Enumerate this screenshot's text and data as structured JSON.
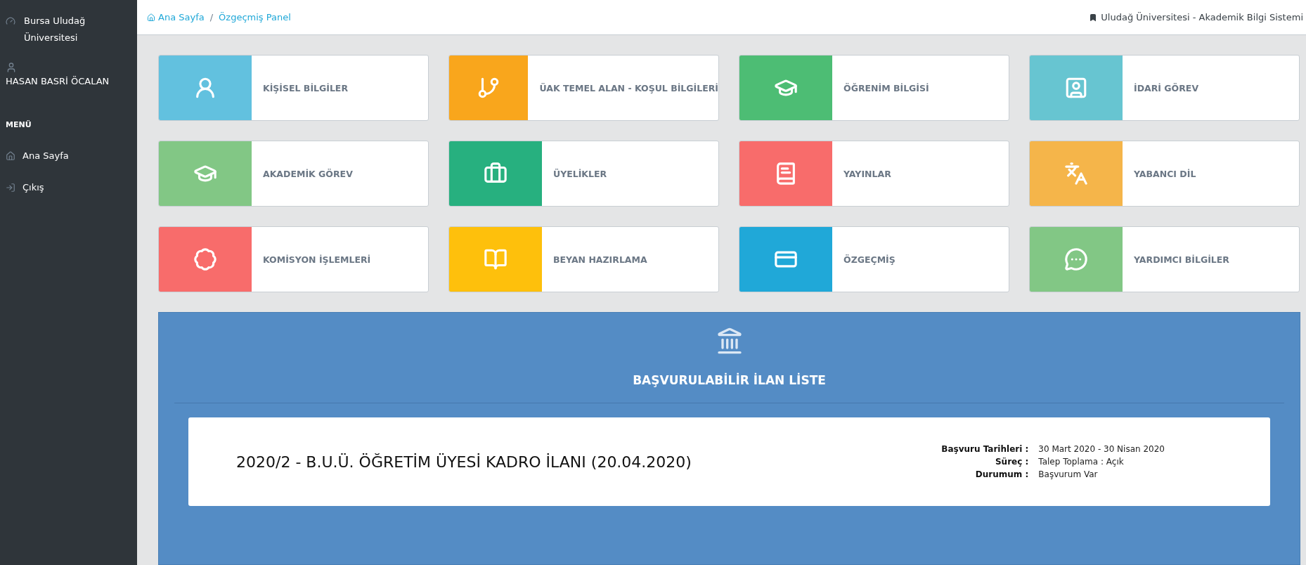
{
  "sidebar": {
    "brand": "Bursa Uludağ Üniversitesi",
    "user": "HASAN BASRİ ÖCALAN",
    "menu_heading": "MENÜ",
    "items": [
      {
        "label": "Ana Sayfa"
      },
      {
        "label": "Çıkış"
      }
    ]
  },
  "breadcrumb": [
    {
      "label": "Ana Sayfa"
    },
    {
      "label": "Özgeçmiş Panel"
    }
  ],
  "breadcrumb_separator": "/",
  "system_title": "Uludağ Üniversitesi - Akademik Bilgi Sistemi",
  "tiles": [
    {
      "label": "KİŞİSEL BİLGİLER",
      "color": "#62c1df"
    },
    {
      "label": "ÜAK TEMEL ALAN - KOŞUL BİLGİLERİ",
      "color": "#f9a61c"
    },
    {
      "label": "ÖĞRENİM BİLGİSİ",
      "color": "#4dbd74"
    },
    {
      "label": "İDARİ GÖREV",
      "color": "#67c5d1"
    },
    {
      "label": "AKADEMİK GÖREV",
      "color": "#82c785"
    },
    {
      "label": "ÜYELİKLER",
      "color": "#27b07f"
    },
    {
      "label": "YAYINLAR",
      "color": "#f86c6b"
    },
    {
      "label": "YABANCI DİL",
      "color": "#f5b54a"
    },
    {
      "label": "KOMİSYON İŞLEMLERİ",
      "color": "#f86c6b"
    },
    {
      "label": "BEYAN HAZIRLAMA",
      "color": "#fec00c"
    },
    {
      "label": "ÖZGEÇMİŞ",
      "color": "#20a8d8"
    },
    {
      "label": "YARDIMCI BİLGİLER",
      "color": "#82c785"
    }
  ],
  "announcements": {
    "title": "BAŞVURULABİLİR İLAN LİSTE",
    "items": [
      {
        "title": "2020/2 - B.U.Ü. ÖĞRETİM ÜYESİ KADRO İLANI (20.04.2020)",
        "details": [
          {
            "label": "Başvuru Tarihleri :",
            "value": "30 Mart 2020 - 30 Nisan 2020"
          },
          {
            "label": "Süreç :",
            "value": "Talep Toplama : Açık"
          },
          {
            "label": "Durumum :",
            "value": "Başvurum Var"
          }
        ]
      }
    ]
  }
}
